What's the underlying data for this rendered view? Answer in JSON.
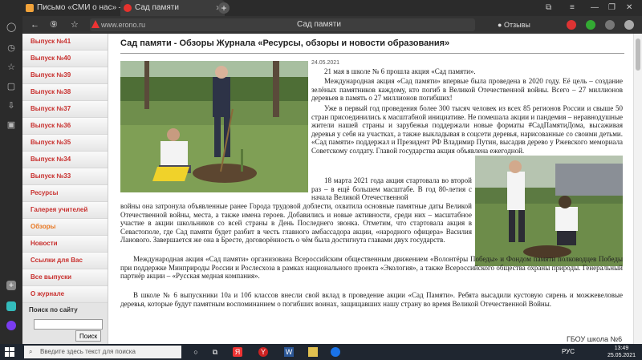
{
  "browser": {
    "tabs": [
      {
        "label": "Письмо «СМИ о нас» — ",
        "icon": "mail-icon",
        "color": "#f2a33a"
      },
      {
        "label": "Сад памяти",
        "icon": "yandex-icon",
        "color": "#e5322d"
      }
    ],
    "url": "www.erono.ru",
    "page_title": "Сад памяти",
    "reviews_label": "Отзывы"
  },
  "nav": {
    "items": [
      {
        "label": "Выпуск №41"
      },
      {
        "label": "Выпуск №40"
      },
      {
        "label": "Выпуск №39"
      },
      {
        "label": "Выпуск №38"
      },
      {
        "label": "Выпуск №37"
      },
      {
        "label": "Выпуск №36"
      },
      {
        "label": "Выпуск №35"
      },
      {
        "label": "Выпуск №34"
      },
      {
        "label": "Выпуск №33"
      },
      {
        "label": "Ресурсы"
      },
      {
        "label": "Галерея учителей"
      },
      {
        "label": "Обзоры"
      },
      {
        "label": "Новости"
      },
      {
        "label": "Ссылки для Вас"
      },
      {
        "label": "Все выпуски"
      },
      {
        "label": "О журнале"
      }
    ],
    "search_label": "Поиск по сайту",
    "search_button": "Поиск"
  },
  "article": {
    "title": "Сад памяти - Обзоры Журнала «Ресурсы, обзоры и новости образования»",
    "date": "24.05.2021",
    "p1": "21 мая в школе № 6 прошла акция «Сад памяти».",
    "p2": "Международная акция «Сад памяти» впервые была проведена в 2020 году. Её цель – создание зелёных памятников каждому, кто погиб в Великой Отечественной войны. Всего – 27 миллионов деревьев в память о 27 миллионов погибших!",
    "p3": "Уже в первый год проведения более 300 тысяч человек из всех 85 регионов России и свыше 50 стран присоединились к масштабной инициативе. Не помешала акции и пандемия – неравнодушные жители нашей страны и зарубежья поддержали новые форматы #СадПамятиДома, высаживая деревья у себя на участках, а также выкладывая в соцсети деревья, нарисованные со своими детьми. «Сад памяти» поддержал и Президент РФ Владимир Путин, высадив дерево у Ржевского мемориала Советскому солдату. Главой государства акция объявлена ежегодной.",
    "p4a": "18 марта 2021 года акция стартовала во второй раз – в ещё большем масштабе. В год 80-летия с начала Великой Отечественной",
    "p4b": "войны она затронула объявленные ранее Города трудовой доблести, охватила основные памятные даты Великой Отечественной войны, места, а также имена героев. Добавились и новые активности, среди них – масштабное участие в акции школьников со всей страны в День Последнего звонка. Отметим, что стартовала акция в Севастополе, где Сад памяти будет разбит в честь главного амбассадора акции, «народного офицера» Василия Ланового. Завершается же она в Бресте, договорённость о чём была достигнута главами двух государств.",
    "p5": "Международная акция «Сад памяти» организована Всероссийским общественным движением «Волонтёры Победы» и Фондом памяти полководцев Победы при поддержке Минприроды России и Рослесхоза в рамках национального проекта «Экология», а также Всероссийского общества охраны природы. Генеральный партнёр акции – «Русская медная компания».",
    "p6": "В школе № 6 выпускники 10а и 10б классов внесли свой вклад в проведение акции «Сад Памяти». Ребята высадили кустовую сирень и можжевеловые деревья, которые будут памятным воспоминанием о погибших воинах, защищавших нашу страну во время Великой Отечественной Войны.",
    "signature": "ГБОУ школа №6"
  },
  "taskbar": {
    "search_placeholder": "Введите здесь текст для поиска",
    "lang": "РУС",
    "time": "13:49",
    "date": "25.05.2021"
  },
  "colors": {
    "nav_link": "#c8302e",
    "nav_active": "#e87722"
  }
}
